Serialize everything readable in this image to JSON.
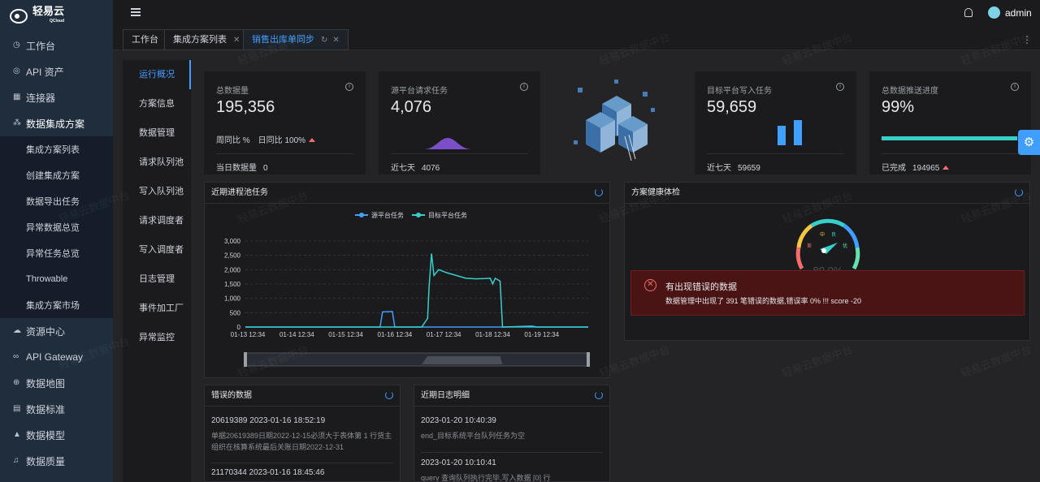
{
  "app": {
    "logo_text": "轻易云",
    "logo_sub": "QCloud",
    "user": "admin",
    "watermark": "轻易云数据中台"
  },
  "sidebar": {
    "items": [
      {
        "label": "工作台",
        "icon": "clock-icon"
      },
      {
        "label": "API 资产",
        "icon": "compass-icon"
      },
      {
        "label": "连接器",
        "icon": "grid-icon"
      },
      {
        "label": "数据集成方案",
        "icon": "share-icon"
      }
    ],
    "sub_items": [
      "集成方案列表",
      "创建集成方案",
      "数据导出任务",
      "异常数据总览",
      "异常任务总览",
      "Throwable",
      "集成方案市场"
    ],
    "items2": [
      {
        "label": "资源中心",
        "icon": "cloud-icon"
      },
      {
        "label": "API Gateway",
        "icon": "link-icon"
      },
      {
        "label": "数据地图",
        "icon": "globe-icon"
      },
      {
        "label": "数据标准",
        "icon": "doc-icon"
      },
      {
        "label": "数据模型",
        "icon": "triangle-icon"
      },
      {
        "label": "数据质量",
        "icon": "bell-icon"
      }
    ]
  },
  "tabs": [
    {
      "label": "工作台"
    },
    {
      "label": "集成方案列表"
    },
    {
      "label": "销售出库单同步"
    }
  ],
  "subnav": [
    "运行概况",
    "方案信息",
    "数据管理",
    "请求队列池",
    "写入队列池",
    "请求调度者",
    "写入调度者",
    "日志管理",
    "事件加工厂",
    "异常监控"
  ],
  "stats": {
    "total": {
      "label": "总数据量",
      "value": "195,356",
      "wow": "周同比 %",
      "dod": "日同比 100%",
      "foot_label": "当日数据量",
      "foot_value": "0"
    },
    "source": {
      "label": "源平台请求任务",
      "value": "4,076",
      "foot_label": "近七天",
      "foot_value": "4076"
    },
    "target": {
      "label": "目标平台写入任务",
      "value": "59,659",
      "foot_label": "近七天",
      "foot_value": "59659"
    },
    "progress": {
      "label": "总数据推送进度",
      "value": "99%",
      "progress": 0.99,
      "foot_label": "已完成",
      "foot_value": "194965"
    }
  },
  "panels": {
    "recent": "近期进程池任务",
    "health": "方案健康体检",
    "errors": "错误的数据",
    "logs": "近期日志明细"
  },
  "health": {
    "gauge_value": "80.0%",
    "gauge_fraction": 0.8,
    "gauge_labels": [
      "中",
      "良",
      "差",
      "优"
    ],
    "err_title": "有出现错误的数据",
    "err_desc": "数据管理中出现了 391 笔错误的数据,错误率 0% !!! score -20"
  },
  "error_rows": [
    {
      "title": "20619389 2023-01-16 18:52:19",
      "desc": "单据20619389日期2022-12-15必须大于表体第 1 行货主组织在核算系统最后关账日期2022-12-31"
    },
    {
      "title": "21170344 2023-01-16 18:45:46",
      "desc": ""
    }
  ],
  "log_rows": [
    {
      "title": "2023-01-20 10:40:39",
      "desc": "end_目标系统平台队列任务为空"
    },
    {
      "title": "2023-01-20 10:10:41",
      "desc": "query 查询队列执行完毕,写入数据 [0] 行"
    }
  ],
  "chart_data": {
    "type": "line",
    "legend": [
      "源平台任务",
      "目标平台任务"
    ],
    "legend_position": "top",
    "x_ticks": [
      "01-13 12:34",
      "01-14 12:34",
      "01-15 12:34",
      "01-16 12:34",
      "01-17 12:34",
      "01-18 12:34",
      "01-19 12:34"
    ],
    "ylim": [
      0,
      3000
    ],
    "y_ticks": [
      "0",
      "500",
      "1,000",
      "1,500",
      "2,000",
      "2,500",
      "3,000"
    ],
    "colors": {
      "source": "#409eff",
      "target": "#36cfc9"
    },
    "series": [
      {
        "name": "源平台任务",
        "points": [
          [
            0,
            0
          ],
          [
            2.75,
            0
          ],
          [
            2.8,
            530
          ],
          [
            3.0,
            540
          ],
          [
            3.05,
            0
          ],
          [
            7,
            0
          ]
        ]
      },
      {
        "name": "目标平台任务",
        "points": [
          [
            0,
            0
          ],
          [
            3.6,
            0
          ],
          [
            3.72,
            300
          ],
          [
            3.75,
            1400
          ],
          [
            3.8,
            2560
          ],
          [
            3.85,
            1800
          ],
          [
            3.95,
            2000
          ],
          [
            4.1,
            1900
          ],
          [
            4.3,
            1800
          ],
          [
            4.5,
            1700
          ],
          [
            4.7,
            1680
          ],
          [
            4.9,
            1690
          ],
          [
            5.0,
            1700
          ],
          [
            5.05,
            1500
          ],
          [
            5.1,
            1700
          ],
          [
            5.2,
            1600
          ],
          [
            5.25,
            0
          ],
          [
            5.85,
            30
          ],
          [
            5.95,
            0
          ],
          [
            7,
            0
          ]
        ]
      }
    ]
  },
  "colors": {
    "accent": "#409eff",
    "teal": "#36cfc9",
    "danger": "#f56c6c",
    "purple": "#7b4fc8"
  }
}
